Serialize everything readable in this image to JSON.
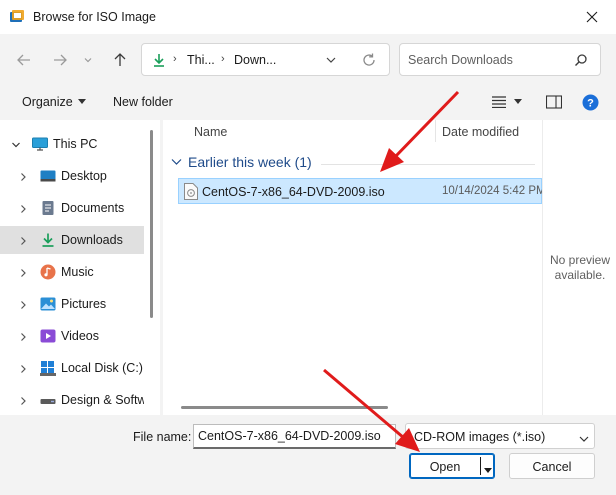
{
  "window": {
    "title": "Browse for ISO Image"
  },
  "address": {
    "segments": [
      "Thi...",
      "Down..."
    ]
  },
  "search": {
    "placeholder": "Search Downloads"
  },
  "toolbar": {
    "organize_label": "Organize",
    "new_folder_label": "New folder"
  },
  "sidebar": {
    "items": [
      {
        "label": "This PC",
        "icon": "pc-icon"
      },
      {
        "label": "Desktop",
        "icon": "desktop-icon"
      },
      {
        "label": "Documents",
        "icon": "documents-icon"
      },
      {
        "label": "Downloads",
        "icon": "downloads-icon",
        "selected": true
      },
      {
        "label": "Music",
        "icon": "music-icon"
      },
      {
        "label": "Pictures",
        "icon": "pictures-icon"
      },
      {
        "label": "Videos",
        "icon": "videos-icon"
      },
      {
        "label": "Local Disk (C:)",
        "icon": "disk-icon"
      },
      {
        "label": "Design & Softw",
        "icon": "drive-icon"
      }
    ]
  },
  "files": {
    "columns": {
      "name": "Name",
      "date": "Date modified"
    },
    "group": "Earlier this week (1)",
    "rows": [
      {
        "name": "CentOS-7-x86_64-DVD-2009.iso",
        "date": "10/14/2024 5:42 PM"
      }
    ]
  },
  "preview": {
    "line1": "No preview",
    "line2": "available."
  },
  "footer": {
    "file_name_label": "File name:",
    "file_name_value": "CentOS-7-x86_64-DVD-2009.iso",
    "file_type": "CD-ROM images (*.iso)",
    "open_label": "Open",
    "cancel_label": "Cancel"
  },
  "colors": {
    "accent": "#0067c0",
    "selection": "#cce8ff",
    "annotation_arrow": "#e01b1b"
  }
}
